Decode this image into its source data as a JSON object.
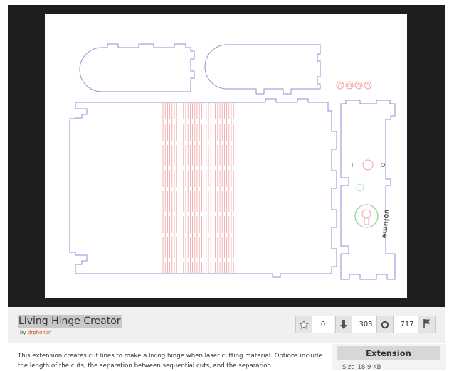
{
  "extension": {
    "title": "Living Hinge Creator",
    "by_prefix": "by",
    "author": "drphonon",
    "description": "This extension creates cut lines to make a living hinge when laser cutting material. Options include the length of the cuts, the separation between sequential cuts, and the separation"
  },
  "stats": {
    "favorites": "0",
    "downloads": "303",
    "views": "717"
  },
  "side_panel": {
    "type_label": "Extension",
    "size_label": "Size",
    "size_value": "18.9 KB"
  },
  "preview": {
    "engraved_text": "volume",
    "left_mark": "I",
    "right_mark": "O"
  },
  "icons": [
    "star-icon",
    "download-arrow-icon",
    "eye-icon",
    "flag-icon"
  ],
  "colors": {
    "outline": "#8f8fd4",
    "cut_lines": "#f2a0a0",
    "engrave": "#8ad88a",
    "viewer_bg": "#1e1e1e",
    "author_link": "#d9531e"
  }
}
